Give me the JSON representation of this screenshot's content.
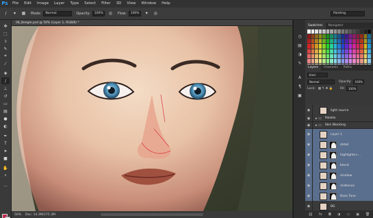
{
  "app": {
    "logo": "Ps"
  },
  "menu": [
    "File",
    "Edit",
    "Image",
    "Layer",
    "Type",
    "Select",
    "Filter",
    "3D",
    "View",
    "Window",
    "Help"
  ],
  "options": {
    "mode_label": "Mode:",
    "mode_value": "Normal",
    "opacity_label": "Opacity:",
    "opacity_value": "100%",
    "flow_label": "Flow:",
    "flow_value": "100%",
    "workspace": "Painting"
  },
  "document": {
    "tab_title": "08_Beegle.psd @ 50% (Layer 1, RGB/8) *",
    "zoom": "50%",
    "doc_size": "Doc: 14.3M/275.3M"
  },
  "panels": {
    "swatches_tabs": [
      "Swatches",
      "Navigator"
    ],
    "layers_tabs": [
      "Layers",
      "Channels",
      "Paths"
    ],
    "kind_label": "Kind",
    "blend_mode": "Normal",
    "opacity_label": "Opacity:",
    "opacity_value": "100%",
    "lock_label": "Lock:",
    "fill_label": "Fill:",
    "fill_value": "100%"
  },
  "layers": [
    {
      "name": "light source",
      "type": "layer",
      "selected": false
    },
    {
      "name": "Palette",
      "type": "group",
      "selected": false
    },
    {
      "name": "Skin Blocking",
      "type": "group",
      "selected": false
    },
    {
      "name": "Layer 1",
      "type": "layer",
      "selected": true
    },
    {
      "name": "detail",
      "type": "masked",
      "selected": true
    },
    {
      "name": "highlights+...",
      "type": "masked",
      "selected": true
    },
    {
      "name": "blend",
      "type": "masked",
      "selected": true
    },
    {
      "name": "shadow",
      "type": "masked",
      "selected": true
    },
    {
      "name": "midtones",
      "type": "masked",
      "selected": true
    },
    {
      "name": "Base Tone",
      "type": "masked",
      "selected": true
    },
    {
      "name": "BG",
      "type": "layer",
      "selected": false
    }
  ],
  "colors": {
    "foreground": "#c12a4f",
    "background": "#f5f5f5",
    "selection": "#5a6e8d",
    "accent": "#31a8ff"
  },
  "icons": {
    "toolbar": [
      "move-icon",
      "marquee-icon",
      "lasso-icon",
      "quick-select-icon",
      "crop-icon",
      "eyedropper-icon",
      "healing-icon",
      "brush-icon",
      "clone-stamp-icon",
      "history-brush-icon",
      "eraser-icon",
      "gradient-icon",
      "blur-icon",
      "dodge-icon",
      "pen-icon",
      "type-icon",
      "path-select-icon",
      "shape-icon",
      "hand-icon",
      "zoom-icon"
    ]
  }
}
